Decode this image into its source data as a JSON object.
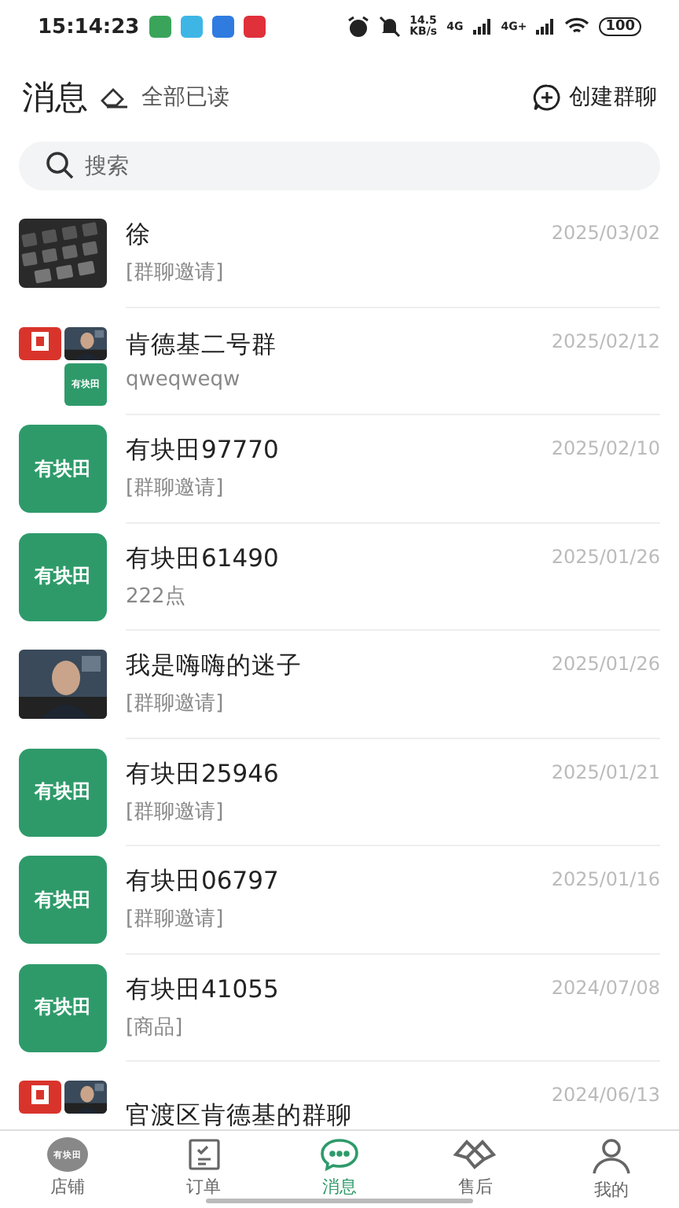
{
  "status_bar": {
    "time": "15:14:23",
    "speed": "14.5",
    "speed_unit": "KB/s",
    "network_1": "4G",
    "network_2": "4G+",
    "battery": "100"
  },
  "header": {
    "title": "消息",
    "mark_read": "全部已读",
    "create_group": "创建群聊"
  },
  "search": {
    "placeholder": "搜索"
  },
  "conversations": [
    {
      "name": "徐",
      "preview": "[群聊邀请]",
      "date": "2025/03/02"
    },
    {
      "avatar": {
        "kind": "group",
        "logo_text": "有块田"
      },
      "name": "肯德基二号群",
      "preview": "qweqweqw",
      "date": "2025/02/12"
    },
    {
      "avatar": {
        "kind": "logo",
        "logo_text": "有块田"
      },
      "name": "有块田97770",
      "preview": "[群聊邀请]",
      "date": "2025/02/10"
    },
    {
      "avatar": {
        "kind": "logo",
        "logo_text": "有块田"
      },
      "name": "有块田61490",
      "preview": "222点",
      "date": "2025/01/26"
    },
    {
      "name": "我是嗨嗨的迷子",
      "preview": "[群聊邀请]",
      "date": "2025/01/26"
    },
    {
      "avatar": {
        "kind": "logo",
        "logo_text": "有块田"
      },
      "name": "有块田25946",
      "preview": "[群聊邀请]",
      "date": "2025/01/21"
    },
    {
      "avatar": {
        "kind": "logo",
        "logo_text": "有块田"
      },
      "name": "有块田06797",
      "preview": "[群聊邀请]",
      "date": "2025/01/16"
    },
    {
      "avatar": {
        "kind": "logo",
        "logo_text": "有块田"
      },
      "name": "有块田41055",
      "preview": "[商品]",
      "date": "2024/07/08"
    },
    {
      "avatar": {
        "kind": "group2"
      },
      "name": "官渡区肯德基的群聊",
      "date": "2024/06/13"
    }
  ],
  "tab_bar": [
    {
      "kind": "store",
      "icon_text": "有块田",
      "label": "店铺",
      "selected": false
    },
    {
      "kind": "orders",
      "label": "订单",
      "selected": false
    },
    {
      "kind": "messages",
      "label": "消息",
      "selected": true
    },
    {
      "kind": "aftersale",
      "label": "售后",
      "selected": false
    },
    {
      "kind": "profile",
      "label": "我的",
      "selected": false
    }
  ]
}
